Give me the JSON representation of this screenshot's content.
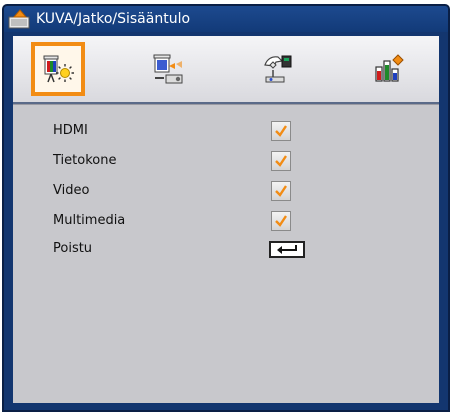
{
  "window": {
    "title": "KUVA/Jatko/Sisääntulo",
    "title_icon": "menu-settings-icon"
  },
  "tabs": [
    {
      "name": "picture",
      "icon": "picture-settings-icon",
      "active": true
    },
    {
      "name": "display",
      "icon": "display-screen-icon",
      "active": false
    },
    {
      "name": "setup",
      "icon": "setup-hand-icon",
      "active": false
    },
    {
      "name": "options",
      "icon": "options-chart-icon",
      "active": false
    }
  ],
  "inputs": [
    {
      "label": "HDMI",
      "checked": true
    },
    {
      "label": "Tietokone",
      "checked": true
    },
    {
      "label": "Video",
      "checked": true
    },
    {
      "label": "Multimedia",
      "checked": true
    }
  ],
  "exit": {
    "label": "Poistu",
    "icon": "enter-key-icon"
  },
  "colors": {
    "frame": "#13366f",
    "panel": "#c8c8cc",
    "tab_highlight": "#f28c14",
    "checkmark": "#f28c14"
  }
}
